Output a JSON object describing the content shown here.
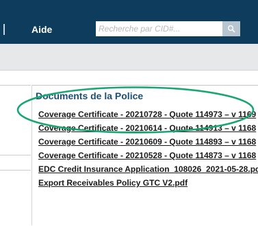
{
  "header": {
    "help_label": "Aide",
    "search": {
      "placeholder": "Recherche par CID#...",
      "value": ""
    },
    "icons": {
      "search": "search-icon"
    }
  },
  "documents": {
    "title": "Documents de la Police",
    "items": [
      {
        "label": "Coverage Certificate - 20210728 - Quote 114973 – v 1169"
      },
      {
        "label": "Coverage Certificate - 20210614 - Quote 114913 – v 1168"
      },
      {
        "label": "Coverage Certificate - 20210609 - Quote 114893 – v 1168"
      },
      {
        "label": "Coverage Certificate - 20210528 - Quote 114873 – v 1168"
      },
      {
        "label": "EDC Credit Insurance Application_108026_2021-05-28.pd"
      },
      {
        "label": "Export Receivables Policy GTC V2.pdf"
      }
    ]
  },
  "colors": {
    "header_bg": "#0d3c5c",
    "title": "#1d4e74",
    "annotation_ellipse": "#1aa673"
  }
}
